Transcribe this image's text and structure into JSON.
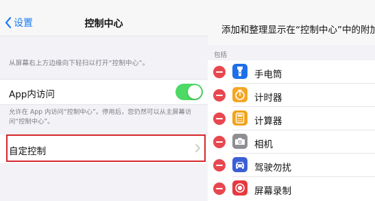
{
  "left_panel": {
    "nav": {
      "back_label": "设置",
      "title": "控制中心"
    },
    "hint_top": "从屏幕右上方边缘向下轻扫以打开“控制中心”。",
    "app_access": {
      "label": "App内访问",
      "toggle_on": true
    },
    "hint_bottom": "允许在 App 内访问“控制中心”。停用后，您仍然可以从主屏幕访问“控制中心”。",
    "customize": {
      "label": "自定控制"
    }
  },
  "right_panel": {
    "title": "添加和整理显示在“控制中心”中的附加",
    "section_label": "包括",
    "items": [
      {
        "label": "手电筒",
        "icon": "flashlight-icon",
        "color": "#1e6fe8"
      },
      {
        "label": "计时器",
        "icon": "timer-icon",
        "color": "#f5a623"
      },
      {
        "label": "计算器",
        "icon": "calculator-icon",
        "color": "#f0a31c"
      },
      {
        "label": "相机",
        "icon": "camera-icon",
        "color": "#8e8e93"
      },
      {
        "label": "驾驶勿扰",
        "icon": "car-icon",
        "color": "#3c5fd6"
      },
      {
        "label": "屏幕录制",
        "icon": "screen-record-icon",
        "color": "#e5393f"
      }
    ]
  },
  "colors": {
    "accent": "#1a7cf5",
    "toggle": "#4cd964",
    "highlight": "#d6262b",
    "delete": "#e8474f"
  }
}
